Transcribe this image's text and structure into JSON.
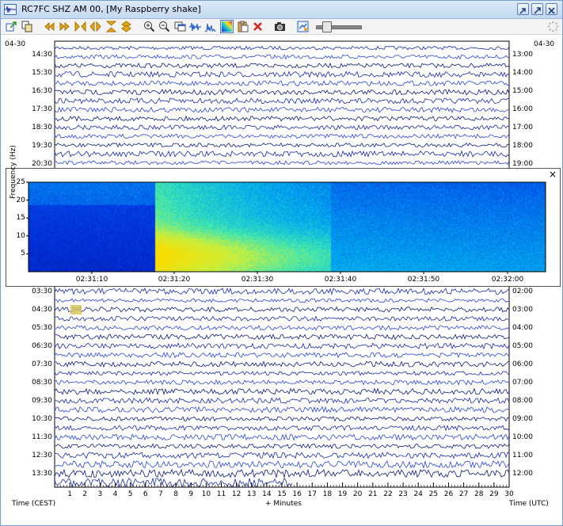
{
  "window": {
    "title": "RC7FC SHZ AM 00, [My Raspberry shake]"
  },
  "toolbar": {
    "icons": [
      "export-icon",
      "copy-icon",
      "rewind-icon",
      "fast-forward-icon",
      "shrink-icon",
      "expand-icon",
      "compress-vertical-icon",
      "stack-icon",
      "zoom-in-icon",
      "zoom-out-icon",
      "window-icon",
      "waveform-icon",
      "spectrum-icon",
      "spectrogram-icon",
      "clipboard-icon",
      "delete-icon",
      "camera-icon",
      "settings-icon",
      "busy-icon"
    ],
    "colors": {
      "accent": "#e3a91c",
      "blue": "#2b62c9",
      "red": "#d52828"
    }
  },
  "helicorder": {
    "date_left": "04-30",
    "date_right": "04-30",
    "top_left_labels": [
      "14:30",
      "15:30",
      "16:30",
      "17:30",
      "18:30",
      "19:30",
      "20:30"
    ],
    "top_right_labels": [
      "13:00",
      "14:00",
      "15:00",
      "16:00",
      "17:00",
      "18:00",
      "19:00"
    ],
    "bottom_left_labels": [
      "03:30",
      "04:30",
      "05:30",
      "06:30",
      "07:30",
      "08:30",
      "09:30",
      "10:30",
      "11:30",
      "12:30",
      "13:30"
    ],
    "bottom_right_labels": [
      "02:00",
      "03:00",
      "04:00",
      "05:00",
      "06:00",
      "07:00",
      "08:00",
      "09:00",
      "10:00",
      "11:00",
      "12:00"
    ],
    "x_ticks": [
      "1",
      "2",
      "3",
      "4",
      "5",
      "6",
      "7",
      "8",
      "9",
      "10",
      "11",
      "12",
      "13",
      "14",
      "15",
      "16",
      "17",
      "18",
      "19",
      "20",
      "21",
      "22",
      "23",
      "24",
      "25",
      "26",
      "27",
      "28",
      "29",
      "30"
    ],
    "xlabel_left": "Time (CEST)",
    "xlabel_center": "+ Minutes",
    "xlabel_right": "Time (UTC)",
    "trace_color": "#1b2aa6"
  },
  "spectrogram": {
    "ylabel": "Frequency (Hz)",
    "y_ticks": [
      "25",
      "20",
      "15",
      "10",
      "5"
    ],
    "x_ticks": [
      "02:31:10",
      "02:31:20",
      "02:31:30",
      "02:31:40",
      "02:31:50",
      "02:32:00"
    ],
    "close_label": "×"
  }
}
